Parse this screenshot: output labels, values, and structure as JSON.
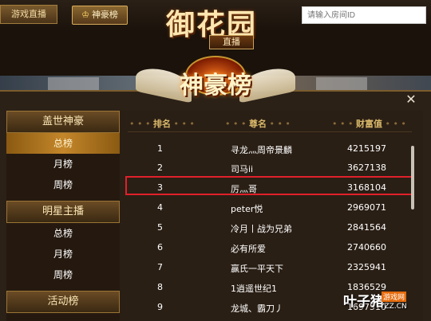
{
  "topbar": {
    "live_label": "游戏直播",
    "rich_label": "神豪榜",
    "search_placeholder": "请输入房间ID"
  },
  "logo": {
    "title": "御花园",
    "subtitle": "直播"
  },
  "emblem": {
    "title": "神豪榜"
  },
  "sidebar": {
    "sections": [
      {
        "header": "盖世神豪",
        "items": [
          "总榜",
          "月榜",
          "周榜"
        ],
        "active_index": 0
      },
      {
        "header": "明星主播",
        "items": [
          "总榜",
          "月榜",
          "周榜"
        ]
      },
      {
        "header": "活动榜",
        "items": []
      }
    ]
  },
  "table": {
    "headers": {
      "rank": "排名",
      "nick": "尊名",
      "wealth": "财富值"
    },
    "rows": [
      {
        "rank": "1",
        "nick": "寻龙灬周帝景麟",
        "wealth": "4215197"
      },
      {
        "rank": "2",
        "nick": "司马ii",
        "wealth": "3627138"
      },
      {
        "rank": "3",
        "nick": "厉灬哥",
        "wealth": "3168104"
      },
      {
        "rank": "4",
        "nick": "peter悦",
        "wealth": "2969071"
      },
      {
        "rank": "5",
        "nick": "冷月丨战为兄弟",
        "wealth": "2841564"
      },
      {
        "rank": "6",
        "nick": "必有所爱",
        "wealth": "2740660"
      },
      {
        "rank": "7",
        "nick": "赢氏一平天下",
        "wealth": "2325941"
      },
      {
        "rank": "8",
        "nick": "1逍遥世纪1",
        "wealth": "1836529"
      },
      {
        "rank": "9",
        "nick": "龙城、霸刀丿",
        "wealth": "1697510"
      }
    ],
    "highlight_rank": "3"
  },
  "watermark": {
    "main": "叶子猪",
    "tag": "游戏网",
    "url": "YZZ.CN"
  },
  "colors": {
    "highlight_border": "#e0202a",
    "header_gold": "#d9b86a",
    "active_tab": "#c4862a"
  }
}
